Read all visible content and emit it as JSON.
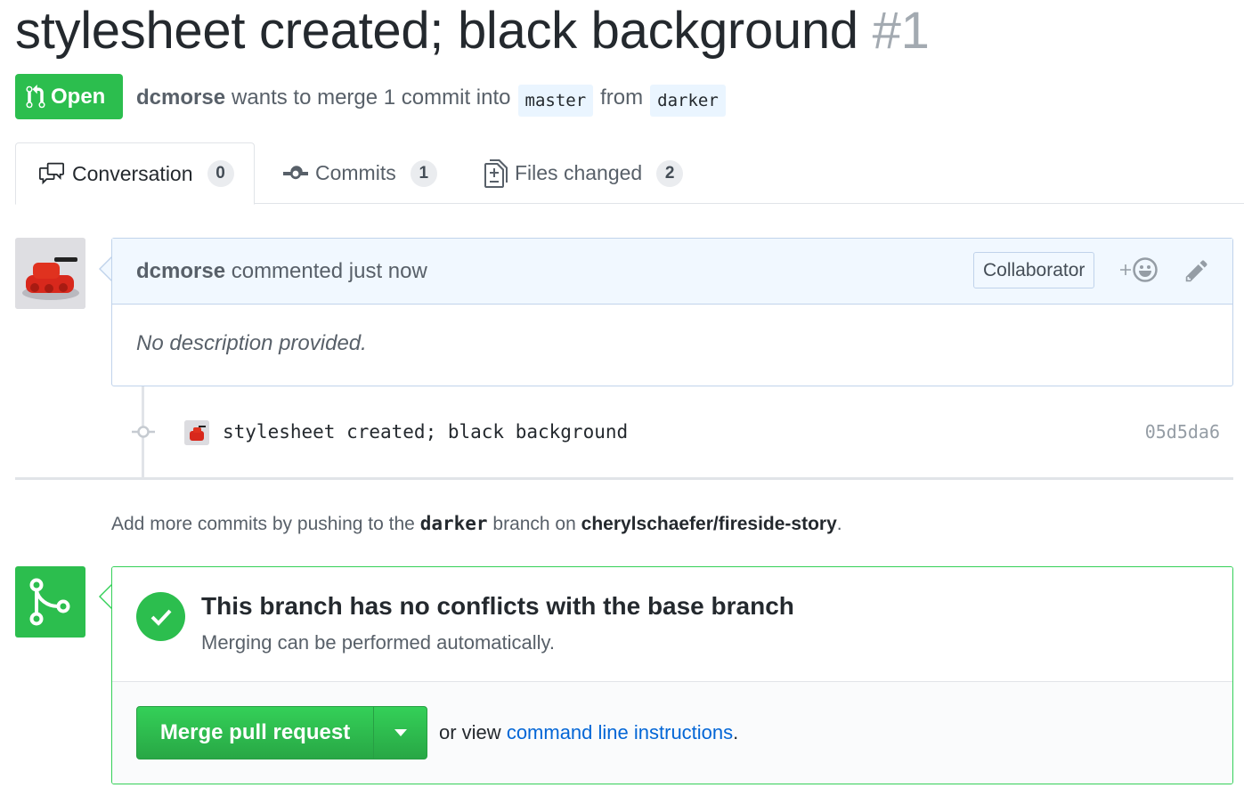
{
  "pr": {
    "title": "stylesheet created; black background",
    "number": "#1",
    "state": "Open",
    "author": "dcmorse",
    "merge_text": "wants to merge 1 commit into",
    "base_branch": "master",
    "from_text": "from",
    "head_branch": "darker"
  },
  "tabs": [
    {
      "label": "Conversation",
      "count": "0",
      "icon": "comment-discussion-icon"
    },
    {
      "label": "Commits",
      "count": "1",
      "icon": "git-commit-icon"
    },
    {
      "label": "Files changed",
      "count": "2",
      "icon": "file-diff-icon"
    }
  ],
  "comment": {
    "author": "dcmorse",
    "action": "commented",
    "time": "just now",
    "role_badge": "Collaborator",
    "body": "No description provided."
  },
  "commit": {
    "message": "stylesheet created; black background",
    "sha": "05d5da6"
  },
  "hint": {
    "prefix": "Add more commits by pushing to the",
    "branch": "darker",
    "middle": "branch on",
    "repo": "cherylschaefer/fireside-story",
    "suffix": "."
  },
  "merge": {
    "title": "This branch has no conflicts with the base branch",
    "subtitle": "Merging can be performed automatically.",
    "button_label": "Merge pull request",
    "alt_prefix": "or view",
    "alt_link": "command line instructions",
    "alt_suffix": "."
  },
  "colors": {
    "success": "#2cbe4e",
    "link": "#0366d6",
    "comment_header_bg": "#f1f8ff"
  }
}
